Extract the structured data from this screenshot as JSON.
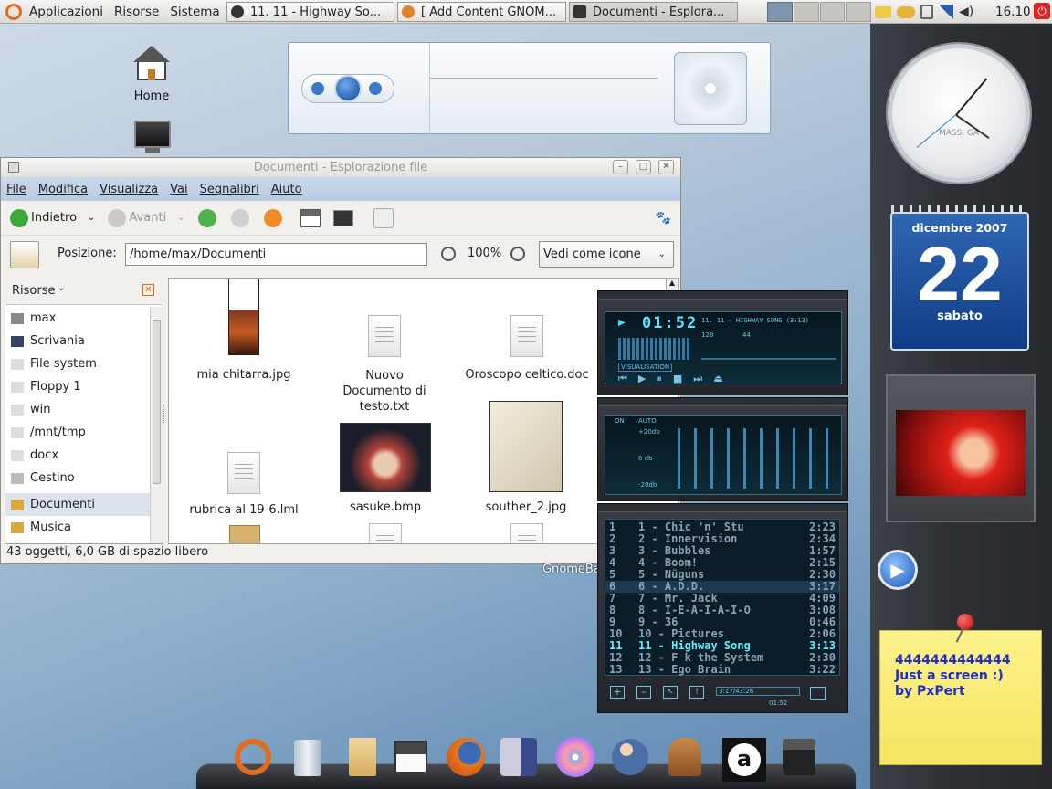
{
  "panel": {
    "menus": [
      "Applicazioni",
      "Risorse",
      "Sistema"
    ],
    "tasks": [
      {
        "label": "11. 11 - Highway So..."
      },
      {
        "label": "[ Add Content GNOM..."
      },
      {
        "label": "Documenti - Esplora..."
      }
    ],
    "time": "16.10"
  },
  "desktop": {
    "icons": [
      "Home",
      "Computer"
    ],
    "gnomebar_label": "GnomeBa"
  },
  "file_manager": {
    "title": "Documenti - Esplorazione file",
    "menu": [
      "File",
      "Modifica",
      "Visualizza",
      "Vai",
      "Segnalibri",
      "Aiuto"
    ],
    "toolbar": {
      "back": "Indietro",
      "forward": "Avanti"
    },
    "location_label": "Posizione:",
    "location": "/home/max/Documenti",
    "zoom": "100%",
    "view_mode": "Vedi come icone",
    "sidebar_title": "Risorse",
    "sidebar": [
      "max",
      "Scrivania",
      "File system",
      "Floppy 1",
      "win",
      "/mnt/tmp",
      "docx",
      "Cestino",
      "Documenti",
      "Musica"
    ],
    "files": [
      "mia chitarra.jpg",
      "Nuovo Documento di testo.txt",
      "Oroscopo celtico.doc",
      "rubrica al 19-6.lml",
      "sasuke.bmp",
      "souther_2.jpg"
    ],
    "status": "43 oggetti, 6,0 GB di spazio libero"
  },
  "winamp": {
    "time": "01:52",
    "song": "11. 11 - HIGHWAY SONG (3:13)",
    "bitrate": "128",
    "khz": "44",
    "vis_label": "VISUALISATION",
    "eq": {
      "on": "ON",
      "auto": "AUTO",
      "top": "+20db",
      "mid": "0 db",
      "bottom": "-20db"
    },
    "playlist": [
      {
        "n": "1",
        "t": "1 - Chic 'n' Stu",
        "d": "2:23"
      },
      {
        "n": "2",
        "t": "2 - Innervision",
        "d": "2:34"
      },
      {
        "n": "3",
        "t": "3 - Bubbles",
        "d": "1:57"
      },
      {
        "n": "4",
        "t": "4 - Boom!",
        "d": "2:15"
      },
      {
        "n": "5",
        "t": "5 - Nüguns",
        "d": "2:30"
      },
      {
        "n": "6",
        "t": "6 - A.D.D.",
        "d": "3:17"
      },
      {
        "n": "7",
        "t": "7 - Mr. Jack",
        "d": "4:09"
      },
      {
        "n": "8",
        "t": "8 - I-E-A-I-A-I-O",
        "d": "3:08"
      },
      {
        "n": "9",
        "t": "9 - 36",
        "d": "0:46"
      },
      {
        "n": "10",
        "t": "10 - Pictures",
        "d": "2:06"
      },
      {
        "n": "11",
        "t": "11 - Highway Song",
        "d": "3:13"
      },
      {
        "n": "12",
        "t": "12 - F  k the System",
        "d": "2:30"
      },
      {
        "n": "13",
        "t": "13 - Ego Brain",
        "d": "3:22"
      }
    ],
    "total": "3:17/43:26",
    "mini_time": "01:52"
  },
  "clock": {
    "label": "MASSI GA"
  },
  "calendar": {
    "month": "dicembre 2007",
    "day": "22",
    "weekday": "sabato"
  },
  "note": {
    "lines": [
      "4444444444444",
      "Just a screen :)",
      "by PxPert"
    ]
  },
  "colors": {
    "panel": "#dcdbd6",
    "menubar": "#b7cbe3",
    "dock": "#2e3136",
    "calendar": "#1f52a0",
    "note": "#f9ec74",
    "note_text": "#1f2ec8",
    "playlist_current": "#5ff0ff"
  }
}
